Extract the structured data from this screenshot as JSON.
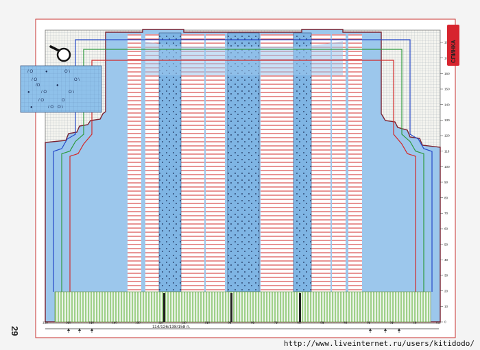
{
  "page": {
    "number": "29",
    "tab_label": "СПИНКА",
    "sizes_caption": "114/126/138/158 п.",
    "url": "http://www.liveinternet.ru/users/kitidodo/"
  },
  "chart": {
    "x_ticks": [
      "170",
      "160",
      "150",
      "140",
      "130",
      "120",
      "110",
      "100",
      "90",
      "80",
      "70",
      "60",
      "50",
      "40",
      "30",
      "20",
      "10",
      "0"
    ],
    "y_ticks": [
      "180",
      "170",
      "160",
      "150",
      "140",
      "130",
      "120",
      "110",
      "100",
      "90",
      "80",
      "70",
      "60",
      "50",
      "40",
      "30",
      "20",
      "10",
      "0"
    ],
    "size_arrows": 6
  },
  "colors": {
    "outline": "#7a2230",
    "fill": "#9cc7ec",
    "panel": "#7fb5e4",
    "red": "#d22a2a",
    "green": "#2e9a3e",
    "blue": "#2447c8",
    "rib": "#a8d38c",
    "tab": "#d7242e"
  },
  "legend": {
    "icon": "magnifier-icon"
  }
}
